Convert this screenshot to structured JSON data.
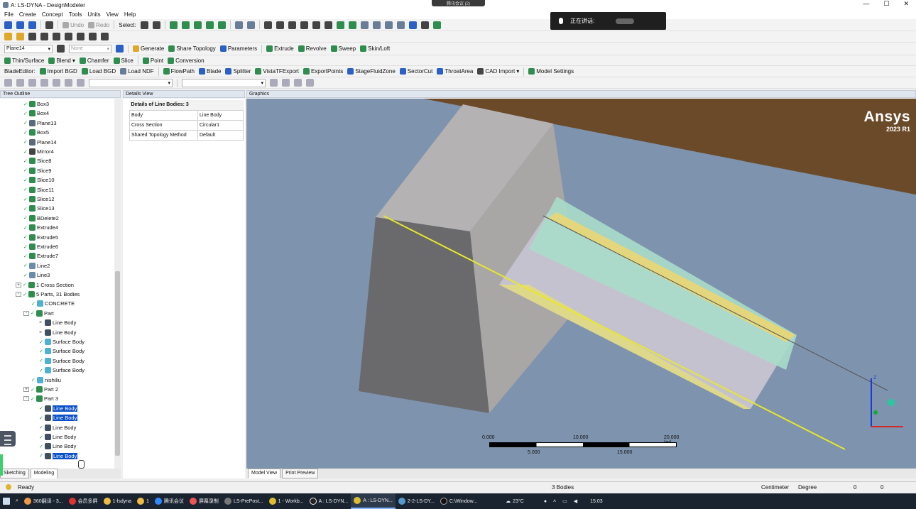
{
  "window": {
    "title": "A: LS-DYNA - DesignModeler",
    "top_clip": "腾讯会议 (2)"
  },
  "menu": [
    "File",
    "Create",
    "Concept",
    "Tools",
    "Units",
    "View",
    "Help"
  ],
  "toolbar1": {
    "undo": "Undo",
    "redo": "Redo",
    "select_label": "Select:"
  },
  "toolbar3": {
    "plane_value": "Plane14",
    "sketch_value": "None",
    "buttons": [
      "Generate",
      "Share Topology",
      "Parameters",
      "Extrude",
      "Revolve",
      "Sweep",
      "Skin/Loft"
    ]
  },
  "toolbar4": {
    "buttons": [
      "Thin/Surface",
      "Blend",
      "Chamfer",
      "Slice",
      "Point",
      "Conversion"
    ]
  },
  "toolbar5": {
    "prefix": "BladeEditor:",
    "buttons": [
      "Import BGD",
      "Load BGD",
      "Load NDF",
      "FlowPath",
      "Blade",
      "Splitter",
      "VistaTFExport",
      "ExportPoints",
      "StageFluidZone",
      "SectorCut",
      "ThroatArea",
      "CAD Import",
      "Model Settings"
    ]
  },
  "meeting": {
    "text": "正在讲话:"
  },
  "panels": {
    "tree_title": "Tree Outline",
    "details_title": "Details View",
    "graphics_title": "Graphics"
  },
  "tree": [
    {
      "label": "Box3",
      "indent": 1,
      "icon": "box"
    },
    {
      "label": "Box4",
      "indent": 1,
      "icon": "box"
    },
    {
      "label": "Plane13",
      "indent": 1,
      "icon": "plane"
    },
    {
      "label": "Box5",
      "indent": 1,
      "icon": "box"
    },
    {
      "label": "Plane14",
      "indent": 1,
      "icon": "plane"
    },
    {
      "label": "Mirror4",
      "indent": 1,
      "icon": "mirror"
    },
    {
      "label": "Slice8",
      "indent": 1,
      "icon": "slice"
    },
    {
      "label": "Slice9",
      "indent": 1,
      "icon": "slice"
    },
    {
      "label": "Slice10",
      "indent": 1,
      "icon": "slice"
    },
    {
      "label": "Slice11",
      "indent": 1,
      "icon": "slice"
    },
    {
      "label": "Slice12",
      "indent": 1,
      "icon": "slice"
    },
    {
      "label": "Slice13",
      "indent": 1,
      "icon": "slice"
    },
    {
      "label": "BDelete2",
      "indent": 1,
      "icon": "delete"
    },
    {
      "label": "Extrude4",
      "indent": 1,
      "icon": "extrude"
    },
    {
      "label": "Extrude5",
      "indent": 1,
      "icon": "extrude"
    },
    {
      "label": "Extrude6",
      "indent": 1,
      "icon": "extrude"
    },
    {
      "label": "Extrude7",
      "indent": 1,
      "icon": "extrude"
    },
    {
      "label": "Line2",
      "indent": 1,
      "icon": "line"
    },
    {
      "label": "Line3",
      "indent": 1,
      "icon": "line"
    },
    {
      "label": "1 Cross Section",
      "indent": 0,
      "icon": "cross-section",
      "expander": "+"
    },
    {
      "label": "5 Parts, 31 Bodies",
      "indent": 0,
      "icon": "parts",
      "expander": "-"
    },
    {
      "label": "CONCRETE",
      "indent": 2,
      "icon": "body"
    },
    {
      "label": "Part",
      "indent": 1,
      "icon": "part",
      "expander": "-"
    },
    {
      "label": "Line Body",
      "indent": 3,
      "icon": "line-body",
      "check": "x"
    },
    {
      "label": "Line Body",
      "indent": 3,
      "icon": "line-body",
      "check": "x"
    },
    {
      "label": "Surface Body",
      "indent": 3,
      "icon": "surface-body",
      "check": "v"
    },
    {
      "label": "Surface Body",
      "indent": 3,
      "icon": "surface-body",
      "check": "v"
    },
    {
      "label": "Surface Body",
      "indent": 3,
      "icon": "surface-body",
      "check": "v"
    },
    {
      "label": "Surface Body",
      "indent": 3,
      "icon": "surface-body",
      "check": "v"
    },
    {
      "label": "nishiliu",
      "indent": 2,
      "icon": "body"
    },
    {
      "label": "Part 2",
      "indent": 1,
      "icon": "part",
      "expander": "+"
    },
    {
      "label": "Part 3",
      "indent": 1,
      "icon": "part",
      "expander": "-"
    },
    {
      "label": "Line Body",
      "indent": 3,
      "icon": "line-body",
      "check": "v",
      "selected": true
    },
    {
      "label": "Line Body",
      "indent": 3,
      "icon": "line-body",
      "check": "v",
      "selected": true
    },
    {
      "label": "Line Body",
      "indent": 3,
      "icon": "line-body",
      "check": "v"
    },
    {
      "label": "Line Body",
      "indent": 3,
      "icon": "line-body",
      "check": "v"
    },
    {
      "label": "Line Body",
      "indent": 3,
      "icon": "line-body",
      "check": "v"
    },
    {
      "label": "Line Body",
      "indent": 3,
      "icon": "line-body",
      "check": "v",
      "selected": true
    }
  ],
  "tree_tabs": [
    "Sketching",
    "Modeling"
  ],
  "details": {
    "header": "Details of Line Bodies: 3",
    "rows": [
      {
        "k": "Body",
        "v": "Line Body"
      },
      {
        "k": "Cross Section",
        "v": "Circular1"
      },
      {
        "k": "Shared Topology Method",
        "v": "Default"
      }
    ]
  },
  "graphics": {
    "brand": "Ansys",
    "version": "2023 R1",
    "scale": {
      "top": [
        "0.000",
        "10.000",
        "20.000 (m)"
      ],
      "bottom": [
        "5.000",
        "15.000"
      ]
    },
    "axis_label": "Z"
  },
  "graphics_tabs": [
    "Model View",
    "Print Preview"
  ],
  "status": {
    "ready": "Ready",
    "bodies": "3 Bodies",
    "units": "Centimeter",
    "angle": "Degree",
    "x": "0",
    "y": "0"
  },
  "taskbar": {
    "items": [
      "360翻译 - 3...",
      "会员多屏",
      "1-lsdyna",
      "1",
      "腾讯会议",
      "屏幕录制",
      "LS-PrePost...",
      "1 - Workb...",
      "A : LS-DYN...",
      "A : LS-DYN...",
      "2-2-LS-DY...",
      "C:\\Window..."
    ],
    "temp": "23°C",
    "time": "15:03"
  },
  "colors": {
    "accent": "#0a50c8",
    "viewport_bg": "#7e93ae",
    "ground": "#6b4a2a",
    "highlight_line": "#e8e82a"
  }
}
